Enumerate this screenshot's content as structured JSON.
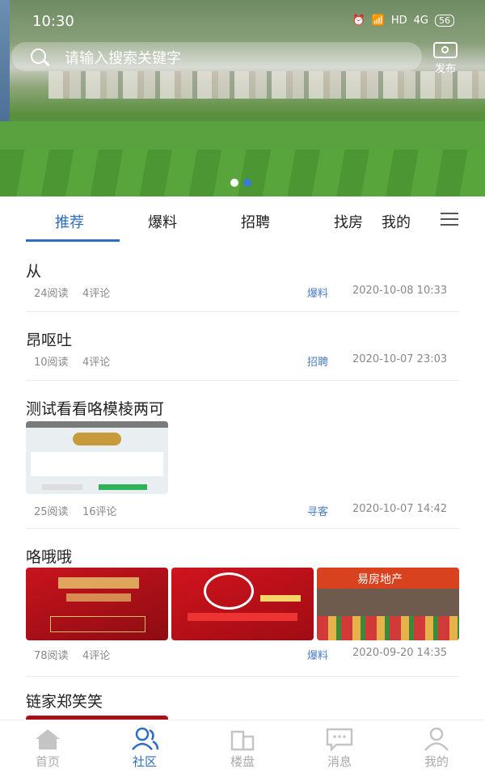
{
  "status": {
    "time": "10:30",
    "network": "HD",
    "signal": "4G",
    "battery": "56"
  },
  "search": {
    "placeholder": "请输入搜索关键字"
  },
  "publish": {
    "label": "发布"
  },
  "tabs": [
    "推荐",
    "爆料",
    "招聘",
    "找房",
    "我的"
  ],
  "posts": [
    {
      "title": "从",
      "reads": "24阅读",
      "comments": "4评论",
      "category": "爆料",
      "date": "2020-10-08 10:33"
    },
    {
      "title": "昂呕吐",
      "reads": "10阅读",
      "comments": "4评论",
      "category": "招聘",
      "date": "2020-10-07 23:03"
    },
    {
      "title": "测试看看咯模棱两可",
      "reads": "25阅读",
      "comments": "16评论",
      "category": "寻客",
      "date": "2020-10-07 14:42"
    },
    {
      "title": "咯哦哦",
      "reads": "78阅读",
      "comments": "4评论",
      "category": "爆料",
      "date": "2020-09-20 14:35"
    },
    {
      "title": "链家郑笑笑"
    }
  ],
  "thumbs": {
    "post4_img3_sign": "易房地产"
  },
  "bottom_nav": [
    "首页",
    "社区",
    "楼盘",
    "消息",
    "我的"
  ],
  "colors": {
    "accent": "#2b6cc4",
    "category": "#4a7ec4"
  }
}
